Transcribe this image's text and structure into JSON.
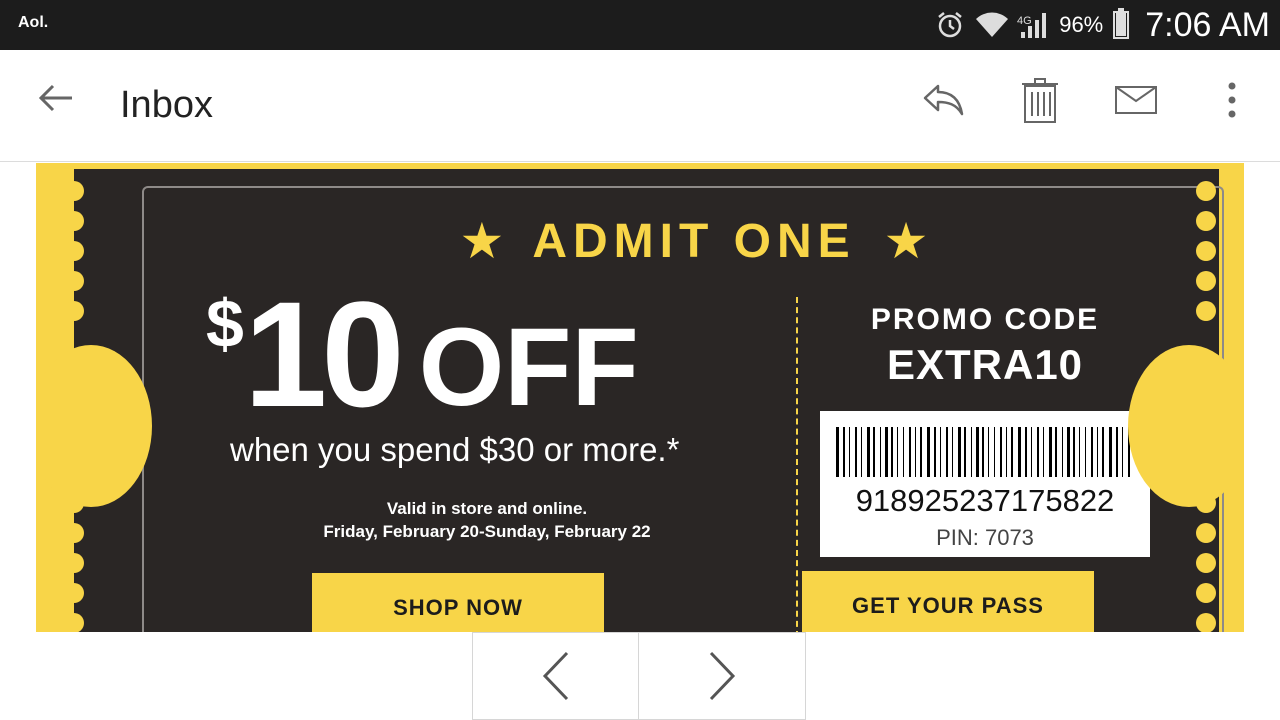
{
  "status_bar": {
    "app_name": "Aol.",
    "battery": "96%",
    "time": "7:06 AM",
    "icons": [
      "alarm-icon",
      "wifi-icon",
      "signal-icon",
      "battery-icon"
    ]
  },
  "header": {
    "title": "Inbox",
    "actions": [
      "back-arrow-icon",
      "reply-icon",
      "trash-icon",
      "mark-unread-icon",
      "more-vert-icon"
    ]
  },
  "coupon": {
    "headline": "ADMIT ONE",
    "dollar_sign": "$",
    "amount": "10",
    "off": "OFF",
    "condition": "when you spend $30 or more.*",
    "valid_line1": "Valid in store and online.",
    "valid_line2": "Friday, February 20-Sunday, February 22",
    "shop_button": "SHOP NOW",
    "promo_label": "PROMO CODE",
    "promo_code": "EXTRA10",
    "barcode_number": "918925237175822",
    "pin": "PIN: 7073",
    "pass_button": "GET YOUR PASS"
  },
  "colors": {
    "accent_yellow": "#f8d548",
    "ticket_dark": "#2a2625",
    "status_bar": "#1c1c1c"
  },
  "pager": {
    "prev_icon": "chevron-left-icon",
    "next_icon": "chevron-right-icon"
  }
}
